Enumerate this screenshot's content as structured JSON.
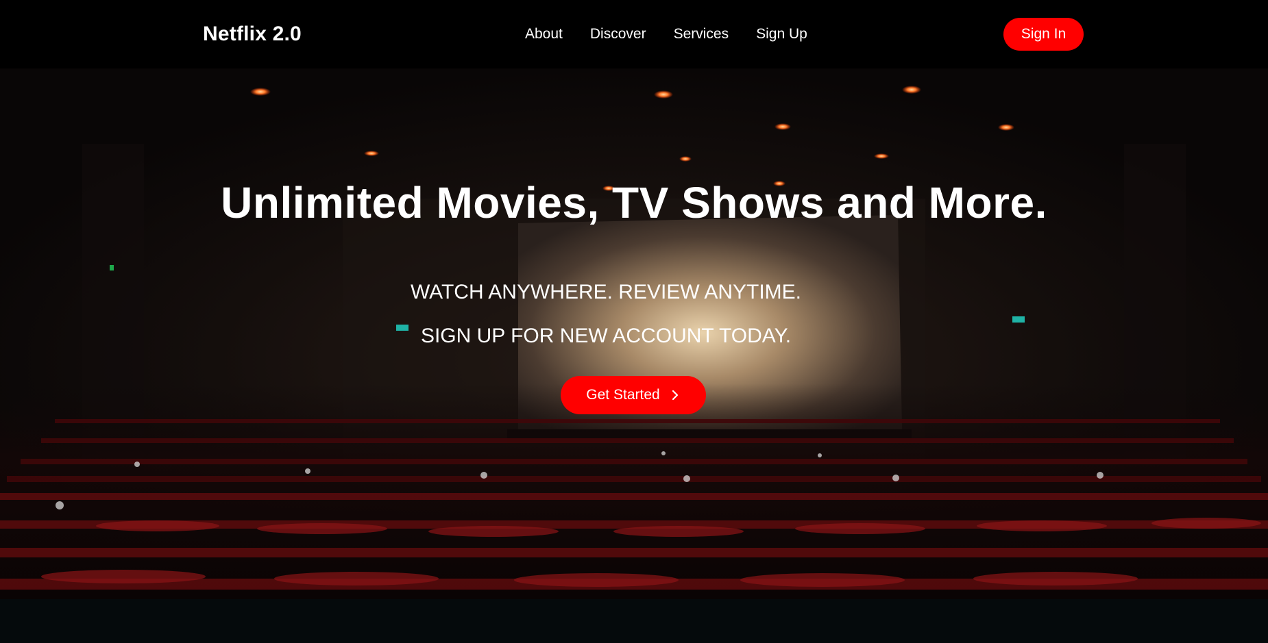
{
  "navbar": {
    "logo": "Netflix 2.0",
    "links": [
      "About",
      "Discover",
      "Services",
      "Sign Up"
    ],
    "signin_label": "Sign In"
  },
  "hero": {
    "title": "Unlimited Movies, TV Shows and More.",
    "tagline_1": "WATCH ANYWHERE. REVIEW ANYTIME.",
    "tagline_2": "SIGN UP FOR NEW ACCOUNT TODAY.",
    "cta_label": "Get Started",
    "cta_icon": "chevron-right-icon",
    "background": "cinema-theater-photo"
  },
  "colors": {
    "accent": "#ff0000",
    "navbar_bg": "#000000",
    "text": "#ffffff",
    "page_bg": "#050a0c"
  }
}
